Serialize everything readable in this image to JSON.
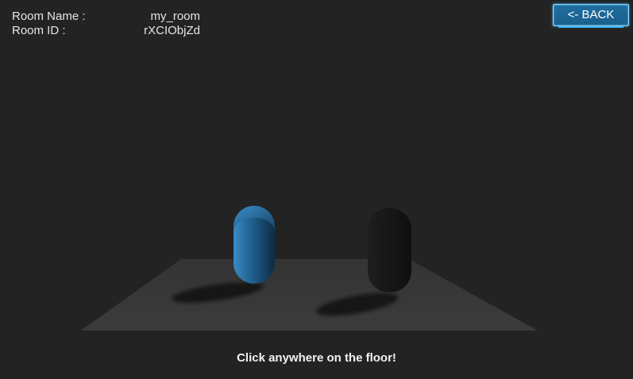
{
  "room_info": {
    "name_label": "Room Name :",
    "name_value": "my_room",
    "id_label": "Room ID :",
    "id_value": "rXCIObjZd"
  },
  "back_button": {
    "label": "<- BACK"
  },
  "hint": {
    "text": "Click anywhere on the floor!"
  },
  "colors": {
    "background": "#232323",
    "floor": "#363636",
    "player_blue": "#2f7fb8",
    "player_black": "#151515",
    "button_accent": "#1f6e9f"
  }
}
